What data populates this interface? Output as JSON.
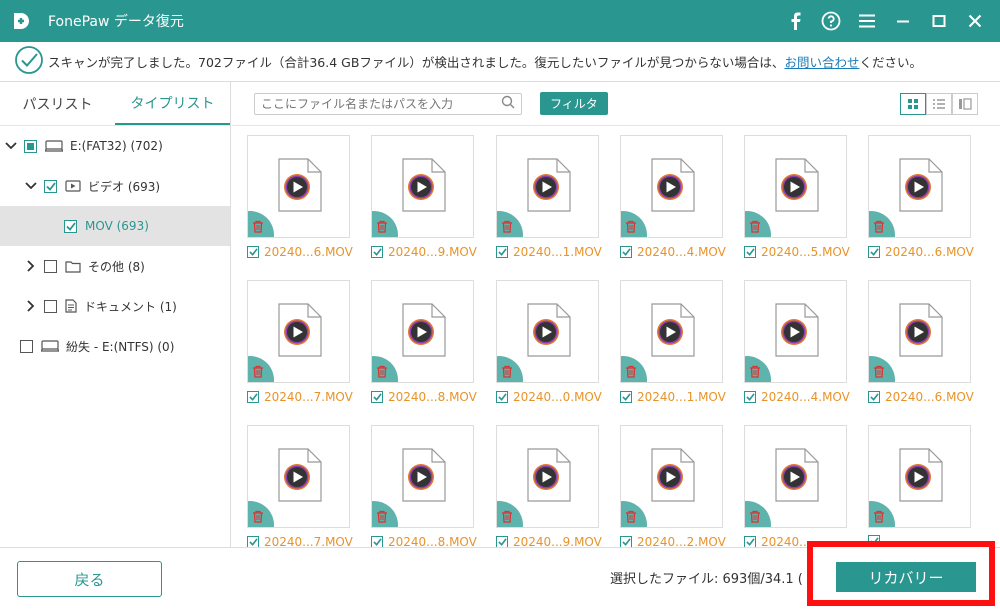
{
  "app": {
    "title": "FonePaw データ復元"
  },
  "notice": {
    "text": "スキャンが完了しました。702ファイル（合計36.4 GBファイル）が検出されました。復元したいファイルが見つからない場合は、",
    "link": "お問い合わせ",
    "suffix": "ください。"
  },
  "sidebar": {
    "tabs": [
      "パスリスト",
      "タイプリスト"
    ],
    "active_tab": "タイプリスト",
    "tree": [
      {
        "label": "E:(FAT32) (702)"
      },
      {
        "label": "ビデオ (693)"
      },
      {
        "label": "MOV (693)"
      },
      {
        "label": "その他 (8)"
      },
      {
        "label": "ドキュメント (1)"
      },
      {
        "label": "紛失 - E:(NTFS) (0)"
      }
    ]
  },
  "toolbar": {
    "search_placeholder": "ここにファイル名またはパスを入力",
    "filter_label": "フィルタ"
  },
  "files": [
    "20240...6.MOV",
    "20240...9.MOV",
    "20240...1.MOV",
    "20240...4.MOV",
    "20240...5.MOV",
    "20240...6.MOV",
    "20240...7.MOV",
    "20240...8.MOV",
    "20240...0.MOV",
    "20240...1.MOV",
    "20240...4.MOV",
    "20240...6.MOV",
    "20240...7.MOV",
    "20240...8.MOV",
    "20240...9.MOV",
    "20240...2.MOV",
    "20240...",
    ""
  ],
  "footer": {
    "back_label": "戻る",
    "selection_text": "選択したファイル: 693個/34.1 (",
    "recover_label": "リカバリー"
  },
  "colors": {
    "accent": "#2a9690",
    "file_text": "#e8932a",
    "highlight": "#ff1010"
  }
}
